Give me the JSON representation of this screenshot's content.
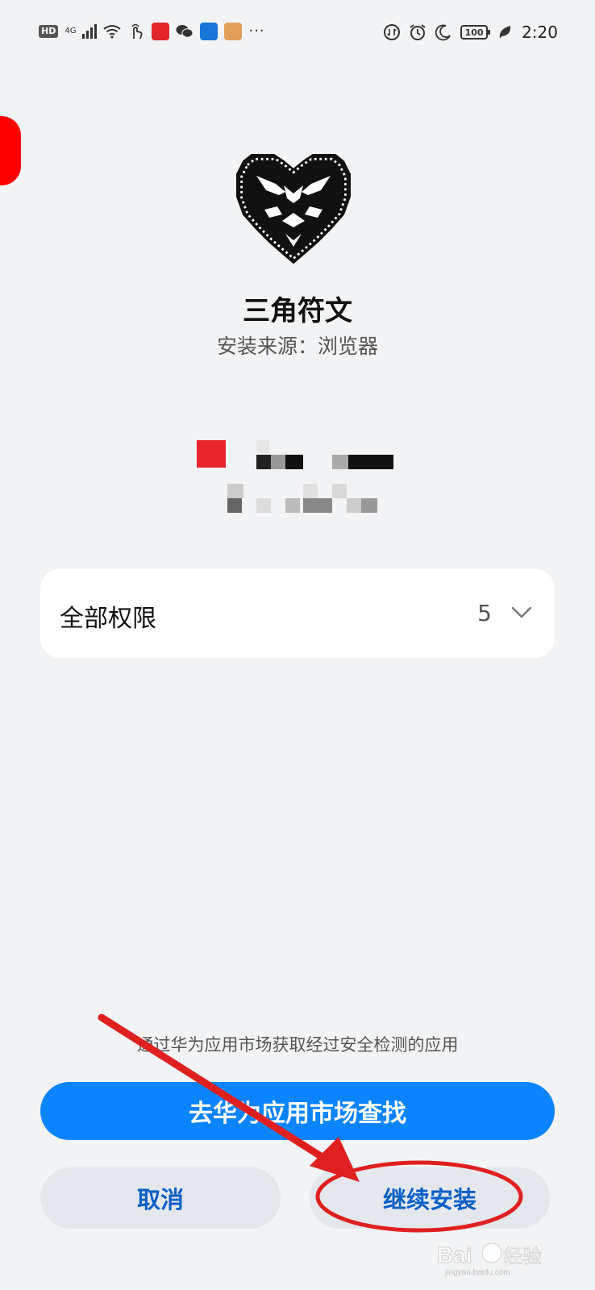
{
  "status_bar": {
    "hd": "HD",
    "network": "4G",
    "time": "2:20",
    "battery": "100",
    "overflow": "···"
  },
  "app": {
    "name": "三角符文",
    "source": "安装来源：浏览器"
  },
  "permissions": {
    "label": "全部权限",
    "count": "5"
  },
  "hint_text": "通过华为应用市场获取经过安全检测的应用",
  "buttons": {
    "market": "去华为应用市场查找",
    "cancel": "取消",
    "continue": "继续安装"
  },
  "colors": {
    "accent": "#0a84ff",
    "secondary_text": "#0a5fc7",
    "annotation": "#e02020",
    "background": "#f1f3f5"
  },
  "watermark": {
    "brand": "Bai du 经验",
    "url": "jingyan.baidu.com"
  }
}
